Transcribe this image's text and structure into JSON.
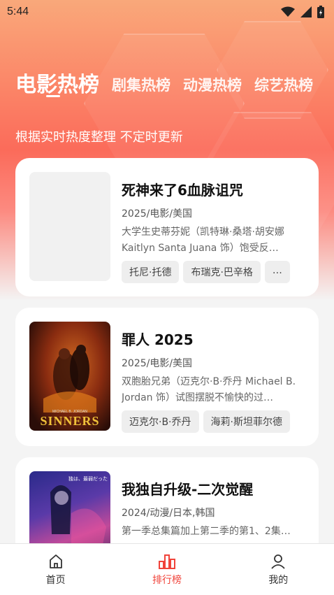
{
  "status_bar": {
    "time": "5:44"
  },
  "tabs": [
    {
      "label": "电影热榜",
      "active": true
    },
    {
      "label": "剧集热榜",
      "active": false
    },
    {
      "label": "动漫热榜",
      "active": false
    },
    {
      "label": "综艺热榜",
      "active": false
    }
  ],
  "subtitle": "根据实时热度整理 不定时更新",
  "items": [
    {
      "title": "死神来了6血脉诅咒",
      "meta": "2025/电影/美国",
      "description": "大学生史蒂芬妮（凯特琳·桑塔·胡安娜 Kaitlyn Santa Juana 饰）饱受反…",
      "tags": [
        "托尼·托德",
        "布瑞克·巴辛格",
        "…"
      ]
    },
    {
      "title": "罪人 2025",
      "meta": "2025/电影/美国",
      "description": "双胞胎兄弟（迈克尔·B·乔丹 Michael B. Jordan 饰）试图摆脱不愉快的过…",
      "tags": [
        "迈克尔·B·乔丹",
        "海莉·斯坦菲尔德"
      ],
      "poster_text": {
        "top": "MICHAEL B. JORDAN",
        "title": "SINNERS"
      }
    },
    {
      "title": "我独自升级-二次觉醒",
      "meta": "2024/动漫/日本,韩国",
      "description": "第一季总集篇加上第二季的第1、2集…",
      "tags": [],
      "poster_text": {
        "top": "独は、最弱だった"
      }
    }
  ],
  "bottom_nav": [
    {
      "label": "首页",
      "icon": "home-icon",
      "active": false
    },
    {
      "label": "排行榜",
      "icon": "ranking-icon",
      "active": true
    },
    {
      "label": "我的",
      "icon": "profile-icon",
      "active": false
    }
  ],
  "colors": {
    "accent": "#f0433a",
    "gradient_top": "#f9a87a",
    "gradient_mid": "#fb6b5a"
  }
}
